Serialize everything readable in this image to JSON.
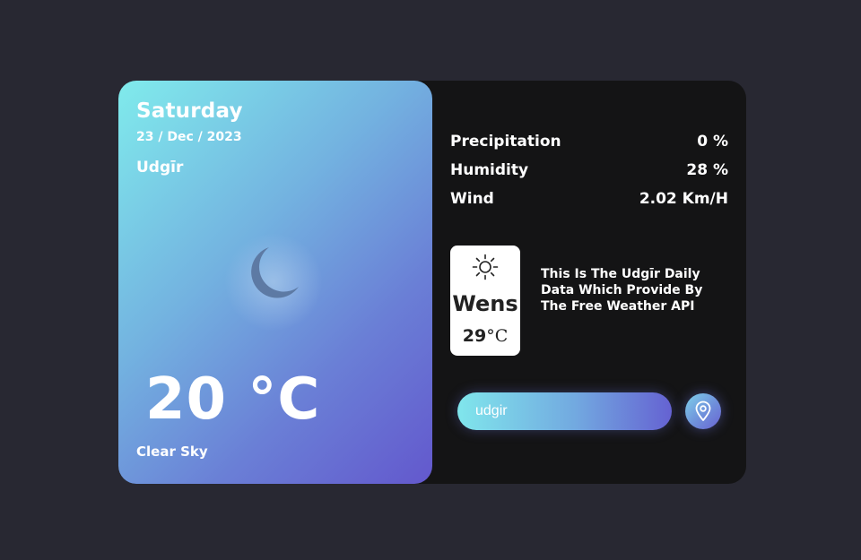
{
  "current": {
    "day": "Saturday",
    "date": "23 / Dec / 2023",
    "city": "Udgīr",
    "temperature": "20 °C",
    "description": "Clear Sky",
    "icon": "moon-icon"
  },
  "stats": [
    {
      "label": "Precipitation",
      "value": "0 %"
    },
    {
      "label": "Humidity",
      "value": "28 %"
    },
    {
      "label": "Wind",
      "value": "2.02 Km/H"
    }
  ],
  "forecast": {
    "day": "Wens",
    "temp_value": "29",
    "temp_unit": "°C",
    "icon": "sun-icon"
  },
  "info_text": "This Is The Udgīr Daily Data Which Provide By The Free Weather API",
  "search": {
    "value": "udgir"
  },
  "location_button": {
    "icon": "location-pin-icon"
  },
  "colors": {
    "background": "#282832",
    "panel": "#141415",
    "gradient_start": "#80ebec",
    "gradient_end": "#6358cd"
  }
}
